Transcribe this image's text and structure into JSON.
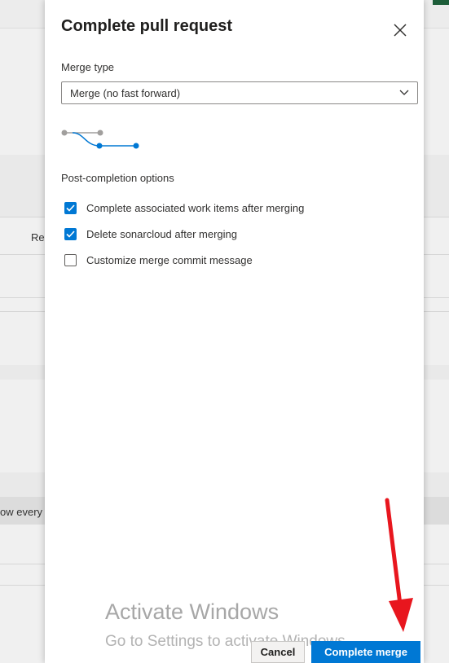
{
  "dialog": {
    "title": "Complete pull request",
    "merge_type_label": "Merge type",
    "merge_type_value": "Merge (no fast forward)",
    "post_completion_label": "Post-completion options",
    "options": [
      {
        "label": "Complete associated work items after merging",
        "checked": true
      },
      {
        "label": "Delete sonarcloud after merging",
        "checked": true
      },
      {
        "label": "Customize merge commit message",
        "checked": false
      }
    ],
    "cancel_label": "Cancel",
    "complete_label": "Complete merge",
    "accent_color": "#0078d4"
  },
  "background": {
    "partial_text_1": "Re",
    "partial_text_2": "ow every"
  },
  "watermark": {
    "title": "Activate Windows",
    "subtitle": "Go to Settings to activate Windows."
  },
  "annotation": {
    "arrow_color": "#e8161e"
  }
}
